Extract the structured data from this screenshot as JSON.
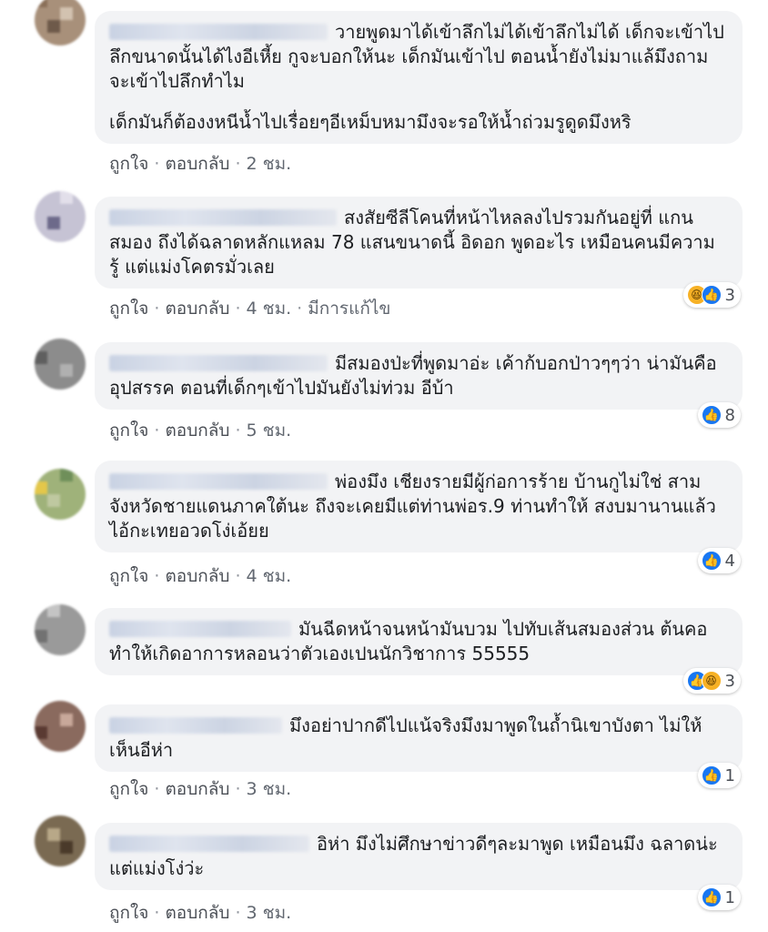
{
  "colors": {
    "like": "#1877f2",
    "haha": "#f7b125",
    "bubble": "#f2f3f5",
    "meta": "#616770"
  },
  "actions": {
    "like": "ถูกใจ",
    "reply": "ตอบกลับ",
    "sep": "·"
  },
  "comments": [
    {
      "lines": [
        "วายพูดมาได้เข้าลึกไม่ได้เข้าลึกไม่ได้ เด็กจะเข้าไปลึกขนาดนั้นได้ไงอีเหี้ย กูจะบอกให้นะ เด็กมันเข้าไป ตอนน้ำยังไม่มาแล้มึงถามจะเข้าไปลึกทำไม",
        "เด็กมันก็ต้องงหนีน้ำไปเรื่อยๆอีเหม็บหมามึงจะรอให้น้ำถ่วมรูดูดมึงหริ"
      ],
      "time": "2 ชม.",
      "edited": "",
      "reaction_icons": [],
      "reaction_count": ""
    },
    {
      "lines": [
        "สงสัยซีลีโคนที่หน้าไหลลงไปรวมกันอยู่ที่ แกนสมอง ถึงได้ฉลาดหลักแหลม 78 แสนขนาดนี้ อิดอก พูดอะไร เหมือนคนมีความรู้ แต่แม่งโคตรมั่วเลย"
      ],
      "time": "4 ชม.",
      "edited": "มีการแก้ไข",
      "reaction_icons": [
        "haha-icon",
        "like-icon"
      ],
      "reaction_count": "3"
    },
    {
      "lines": [
        "มีสมองป่ะที่พูดมาอ่ะ เค้าก้บอกป่าวๆๆว่า น่ามันคืออุปสรรค ตอนที่เด็กๆเข้าไปมันยังไม่ท่วม อีบ้า"
      ],
      "time": "5 ชม.",
      "edited": "",
      "reaction_icons": [
        "like-icon"
      ],
      "reaction_count": "8"
    },
    {
      "lines": [
        "พ่องมึง เชียงรายมีผู้ก่อการร้าย บ้านกูไม่ใช่ สามจังหวัดชายแดนภาคใต้นะ ถึงจะเคยมีแต่ท่านพ่อร.9 ท่านทำให้ สงบมานานแล้ว ไอ้กะเทยอวดโง่เอ้ยย"
      ],
      "time": "4 ชม.",
      "edited": "",
      "reaction_icons": [
        "like-icon"
      ],
      "reaction_count": "4"
    },
    {
      "lines": [
        "มันฉีดหน้าจนหน้ามันบวม ไปทับเส้นสมองส่วน ต้นคอ ทำให้เกิดอาการหลอนว่าตัวเองเปนนักวิชาการ 55555"
      ],
      "time": "",
      "edited": "",
      "reaction_icons": [
        "like-icon",
        "haha-icon"
      ],
      "reaction_count": "3"
    },
    {
      "lines": [
        "มึงอย่าปากดีไปแน้จริงมึงมาพูดในถ้ำนิเขาบังตา ไม่ให้เห็นอีห่า"
      ],
      "time": "3 ชม.",
      "edited": "",
      "reaction_icons": [
        "like-icon"
      ],
      "reaction_count": "1"
    },
    {
      "lines": [
        "อิห่า มึงไม่ศึกษาข่าวดีๆละมาพูด เหมือนมึง ฉลาดน่ะ แต่แม่งโง่ว่ะ"
      ],
      "time": "3 ชม.",
      "edited": "",
      "reaction_icons": [
        "like-icon"
      ],
      "reaction_count": "1"
    }
  ]
}
